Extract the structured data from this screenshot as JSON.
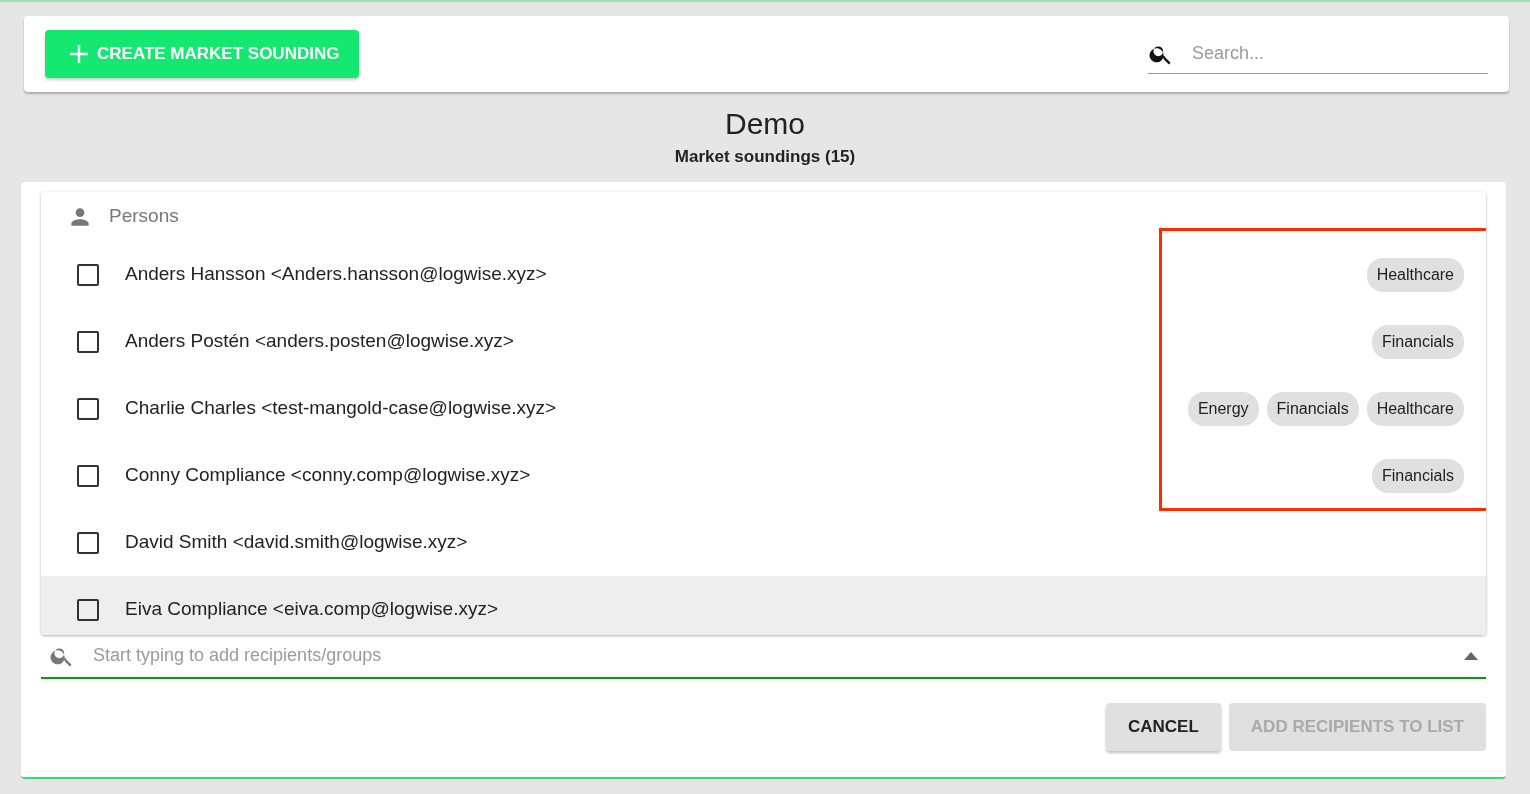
{
  "toolbar": {
    "create_button": "CREATE MARKET SOUNDING",
    "search": {
      "placeholder": "Search..."
    }
  },
  "header": {
    "title": "Demo",
    "subtitle": "Market soundings (15)"
  },
  "list": {
    "section": "Persons",
    "rows": [
      {
        "label": "Anders Hansson <Anders.hansson@logwise.xyz>",
        "checked": false,
        "hovered": false,
        "tags": [
          "Healthcare"
        ]
      },
      {
        "label": "Anders Postén <anders.posten@logwise.xyz>",
        "checked": false,
        "hovered": false,
        "tags": [
          "Financials"
        ]
      },
      {
        "label": "Charlie Charles <test-mangold-case@logwise.xyz>",
        "checked": false,
        "hovered": false,
        "tags": [
          "Energy",
          "Financials",
          "Healthcare"
        ]
      },
      {
        "label": "Conny Compliance <conny.comp@logwise.xyz>",
        "checked": false,
        "hovered": false,
        "tags": [
          "Financials"
        ]
      },
      {
        "label": "David Smith <david.smith@logwise.xyz>",
        "checked": false,
        "hovered": false,
        "tags": []
      },
      {
        "label": "Eiva Compliance <eiva.comp@logwise.xyz>",
        "checked": false,
        "hovered": true,
        "tags": []
      }
    ]
  },
  "recipient_search": {
    "placeholder": "Start typing to add recipients/groups",
    "expanded": true
  },
  "actions": [
    {
      "label": "CANCEL",
      "disabled": false
    },
    {
      "label": "ADD RECIPIENTS TO LIST",
      "disabled": true
    }
  ]
}
